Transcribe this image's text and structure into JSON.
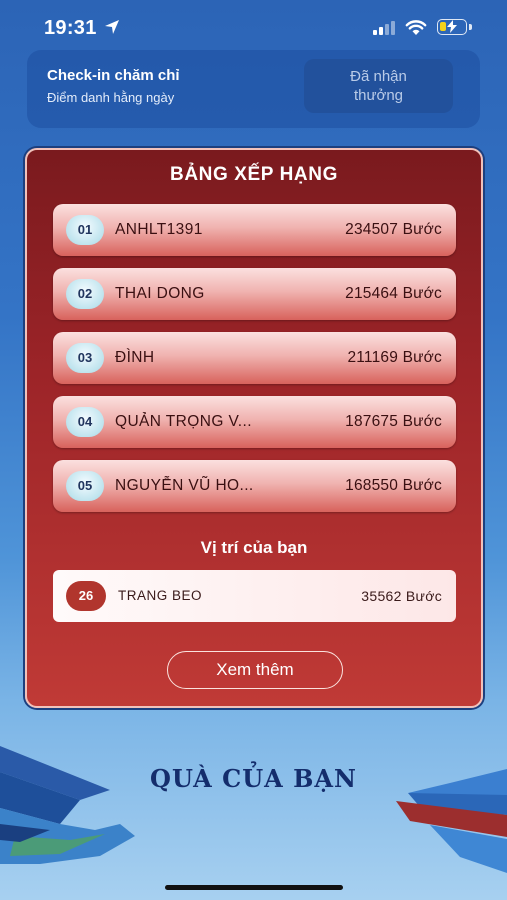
{
  "status_bar": {
    "time": "19:31"
  },
  "checkin": {
    "title": "Check-in chăm chỉ",
    "subtitle": "Điểm danh hằng ngày",
    "button_label": "Đã nhận thưởng"
  },
  "leaderboard": {
    "title": "BẢNG XẾP HẠNG",
    "rows": [
      {
        "rank": "01",
        "name": "ANHLT1391",
        "score": "234507 Bước"
      },
      {
        "rank": "02",
        "name": "THAI DONG",
        "score": "215464 Bước"
      },
      {
        "rank": "03",
        "name": "ĐÌNH",
        "score": "211169 Bước"
      },
      {
        "rank": "04",
        "name": "QUẢN TRỌNG V...",
        "score": "187675 Bước"
      },
      {
        "rank": "05",
        "name": "NGUYỄN VŨ HO...",
        "score": "168550 Bước"
      }
    ],
    "your_position_label": "Vị trí của bạn",
    "your_row": {
      "rank": "26",
      "name": "TRANG BEO",
      "score": "35562 Bước"
    },
    "more_button": "Xem thêm"
  },
  "gifts": {
    "title": "QUÀ CỦA BẠN"
  },
  "colors": {
    "board_red": "#9c2428",
    "background_blue": "#3474c6",
    "title_navy": "#142d6c",
    "badge_red": "#b1352d"
  }
}
